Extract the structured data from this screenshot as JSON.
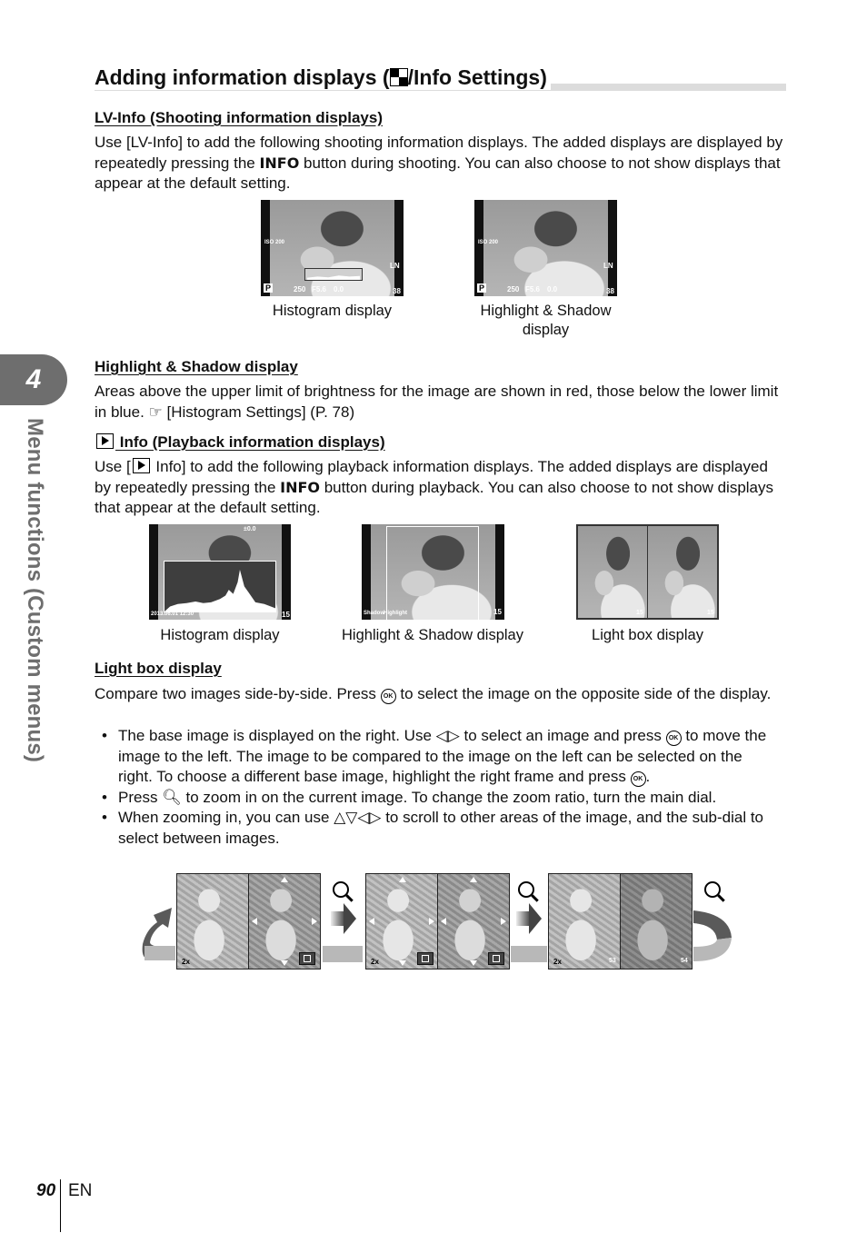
{
  "sidebar": {
    "chapter_number": "4",
    "chapter_title": "Menu functions (Custom menus)"
  },
  "heading": {
    "title_prefix": "Adding information displays (",
    "title_icon": "info-settings-icon",
    "title_suffix": "/Info Settings)"
  },
  "lv_info": {
    "title": "LV-Info (Shooting information displays)",
    "body_1": "Use [LV-Info] to add the following shooting information displays. The added displays are displayed by repeatedly pressing the ",
    "body_bold": "INFO",
    "body_2": " button during shooting. You can also choose to not show displays that appear at the default setting.",
    "screens": [
      {
        "caption": "Histogram display",
        "iso": "ISO 200",
        "shutter": "250",
        "aperture": "F5.6",
        "exposure": "0.0",
        "mode": "P",
        "quality": "LN",
        "shots": "38"
      },
      {
        "caption_line1": "Highlight & Shadow",
        "caption_line2": "display",
        "iso": "ISO 200",
        "shutter": "250",
        "aperture": "F5.6",
        "exposure": "0.0",
        "mode": "P",
        "quality": "LN",
        "shots": "38"
      }
    ]
  },
  "highlight_shadow": {
    "title": "Highlight & Shadow display",
    "body": "Areas above the upper limit of brightness for the image are shown in red, those below the lower limit in blue. ",
    "ref_icon": "☞",
    "ref": " [Histogram Settings] (P. 78)"
  },
  "playback_info": {
    "title": " Info (Playback information displays)",
    "body_1a": "Use [",
    "body_1b": " Info] to add the following playback information displays. The added displays are displayed by repeatedly pressing the ",
    "body_bold": "INFO",
    "body_2": " button during playback. You can also choose to not show displays that appear at the default setting.",
    "screens": [
      {
        "caption": "Histogram display",
        "date": "2013.06.01 12:30",
        "frame": "15",
        "exposure": "±0.0"
      },
      {
        "caption": "Highlight & Shadow display",
        "shadow_label": "Shadow",
        "highlight_label": "Highlight",
        "frame": "15"
      },
      {
        "caption": "Light box display",
        "left_frame": "15",
        "right_frame": "15"
      }
    ]
  },
  "light_box": {
    "title": "Light box display",
    "intro_1": "Compare two images side-by-side. Press ",
    "intro_2": " to select the image on the opposite side of the display.",
    "bullets": [
      {
        "a": "The base image is displayed on the right. Use ",
        "b": " to select an image and press ",
        "c": " to move the image to the left. The image to be compared to the image on the left can be selected on the right. To choose a different base image, highlight the right frame and press ",
        "d": "."
      },
      {
        "a": "Press ",
        "b": " to zoom in on the current image. To change the zoom ratio, turn the main dial."
      },
      {
        "a": "When zooming in, you can use ",
        "b": " to scroll to other areas of the image, and the sub-dial to select between images."
      }
    ],
    "ok_label": "OK",
    "lr_arrows": "◁▷",
    "all_arrows": "△▽◁▷",
    "sequence_labels": {
      "zoom1": "2x",
      "zoom2": "2x",
      "zoom3": "2x",
      "frame_left": "53",
      "frame_right": "54"
    }
  },
  "footer": {
    "page_number": "90",
    "language": "EN"
  }
}
